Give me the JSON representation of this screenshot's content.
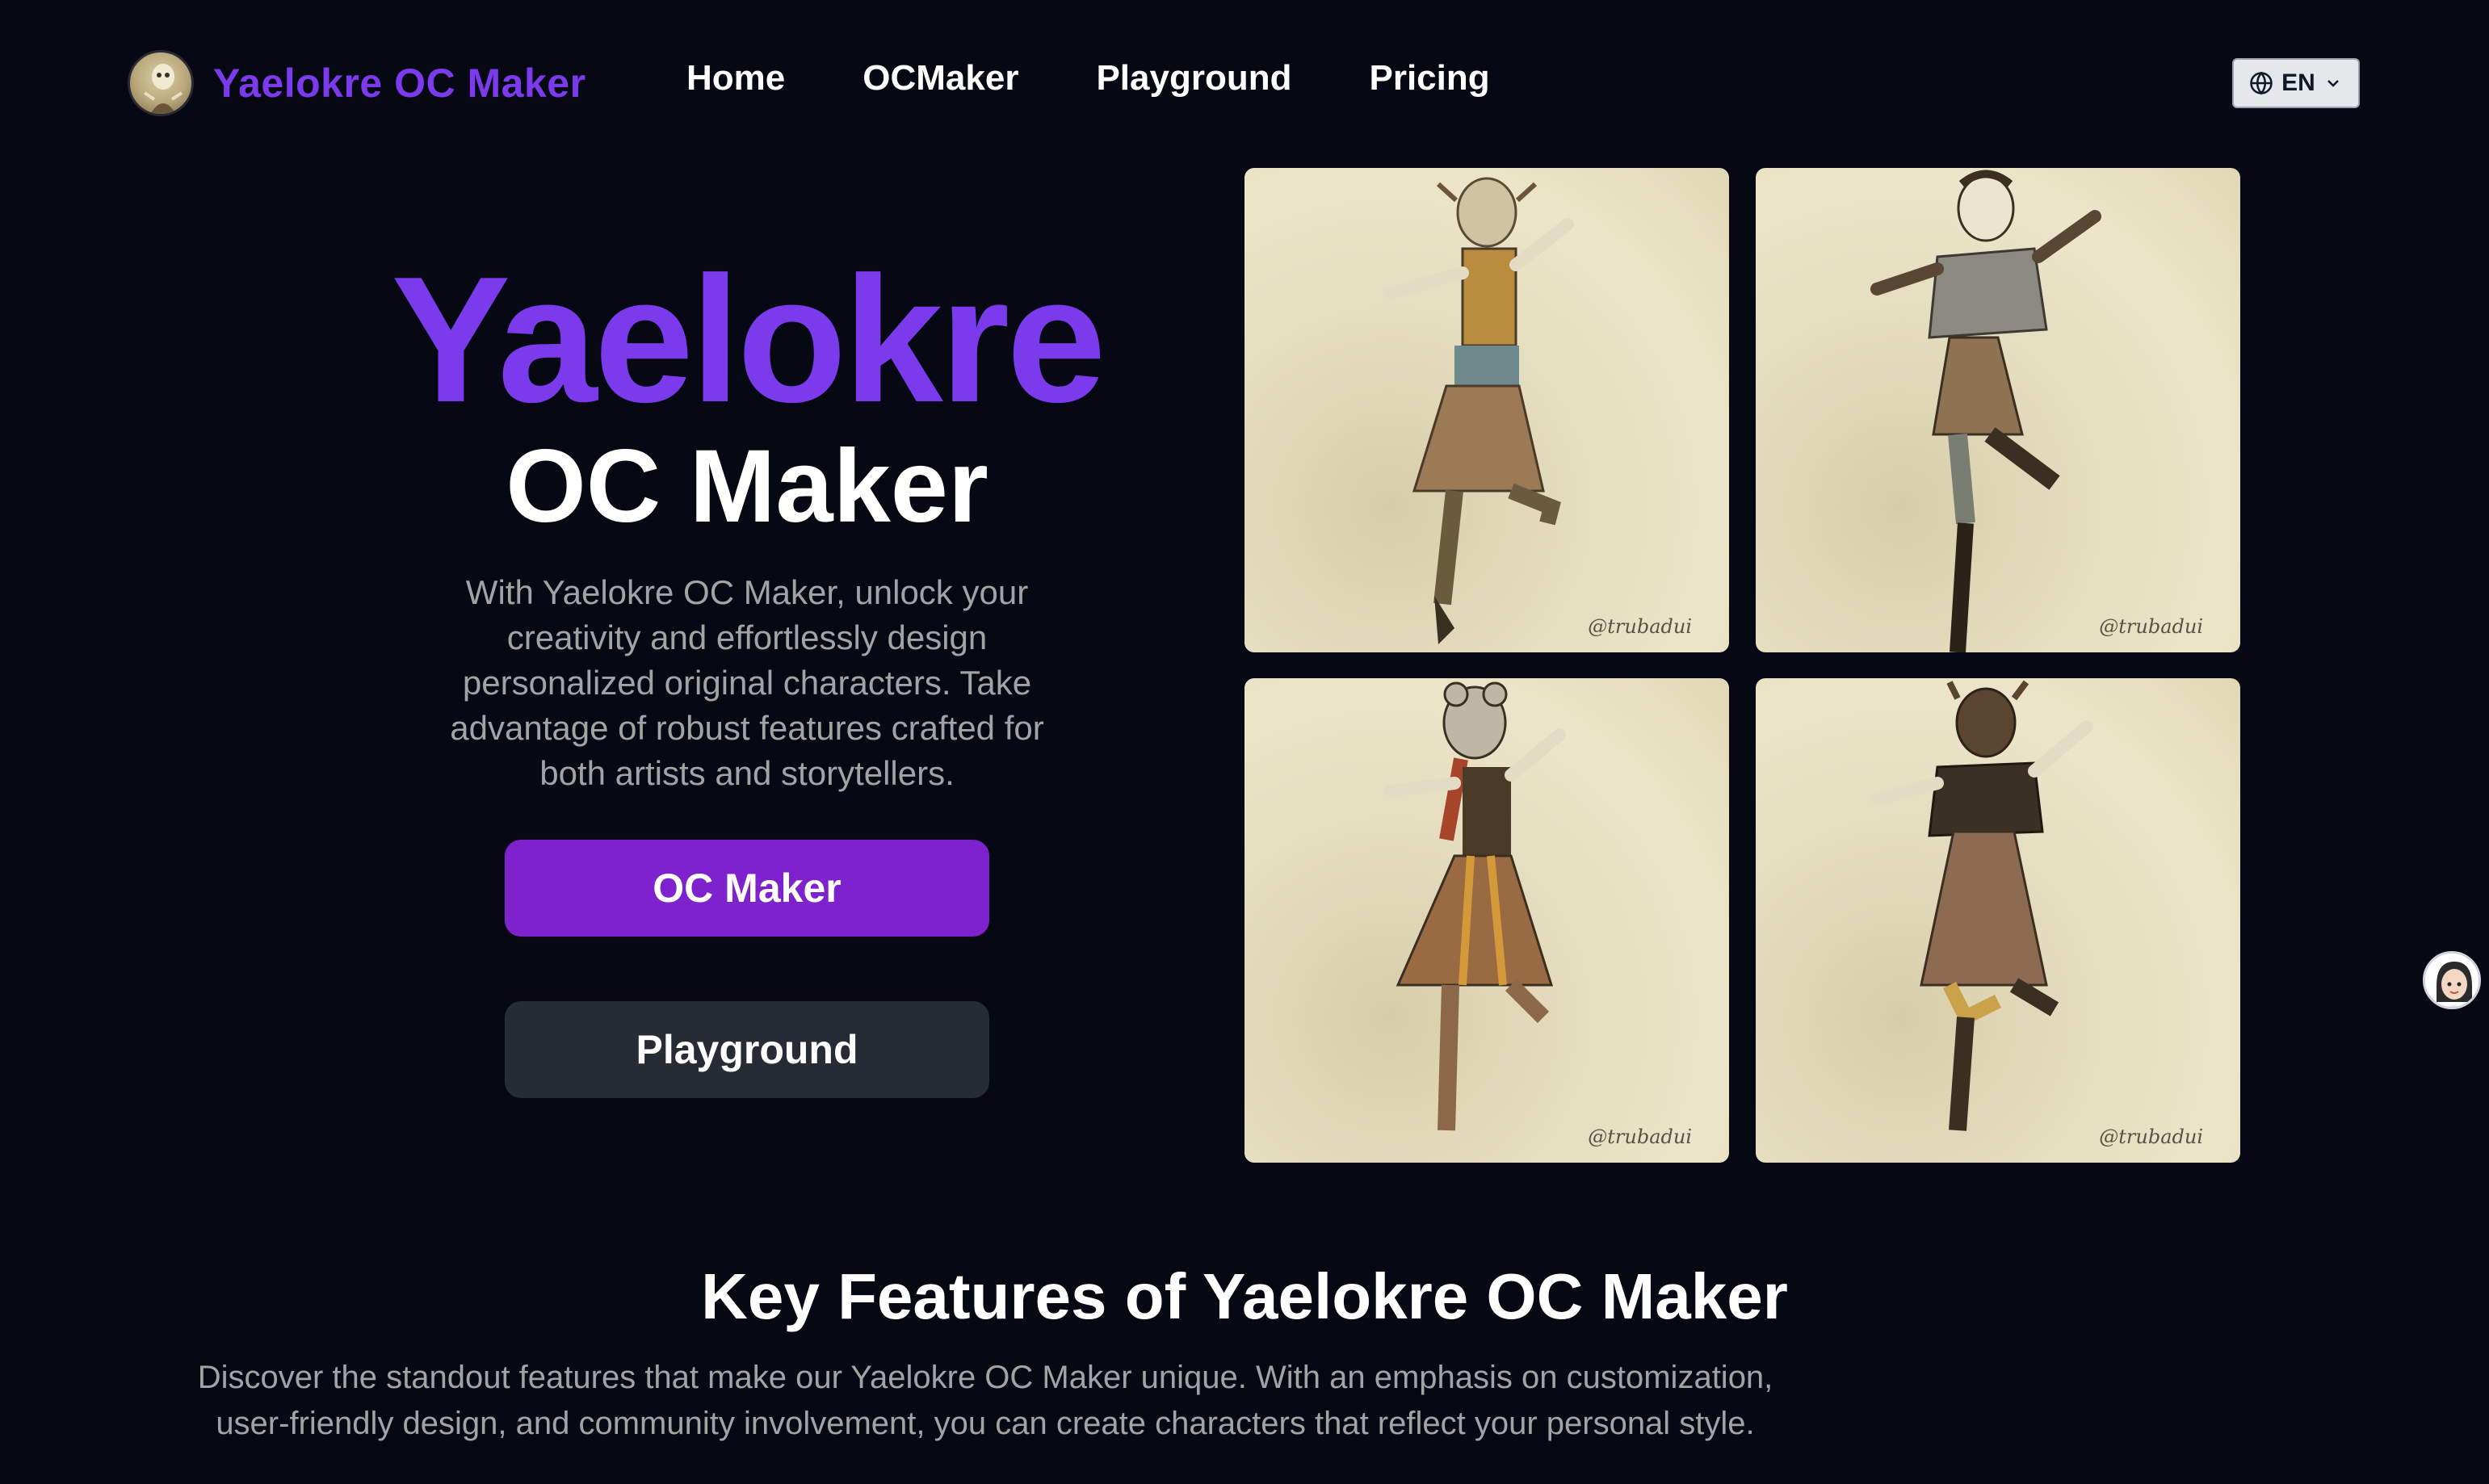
{
  "brand": {
    "name": "Yaelokre OC Maker",
    "logo_icon": "character-avatar-icon"
  },
  "nav": {
    "links": [
      {
        "label": "Home"
      },
      {
        "label": "OCMaker"
      },
      {
        "label": "Playground"
      },
      {
        "label": "Pricing"
      }
    ],
    "language": {
      "label": "EN",
      "icon": "globe-icon",
      "chevron": "chevron-down-icon"
    }
  },
  "hero": {
    "title_line1": "Yaelokre",
    "title_line2": "OC Maker",
    "description": "With Yaelokre OC Maker, unlock your creativity and effortlessly design personalized original characters. Take advantage of robust features crafted for both artists and storytellers.",
    "primary_button": "OC Maker",
    "secondary_button": "Playground"
  },
  "gallery": {
    "items": [
      {
        "signature": "@trubadui"
      },
      {
        "signature": "@trubadui"
      },
      {
        "signature": "@trubadui"
      },
      {
        "signature": "@trubadui"
      }
    ]
  },
  "features": {
    "title": "Key Features of Yaelokre OC Maker",
    "description": "Discover the standout features that make our Yaelokre OC Maker unique. With an emphasis on customization, user-friendly design, and community involvement, you can create characters that reflect your personal style."
  },
  "colors": {
    "accent": "#7c3aed",
    "button_primary": "#7e22ce",
    "background": "#060814",
    "button_secondary": "#272b36"
  }
}
